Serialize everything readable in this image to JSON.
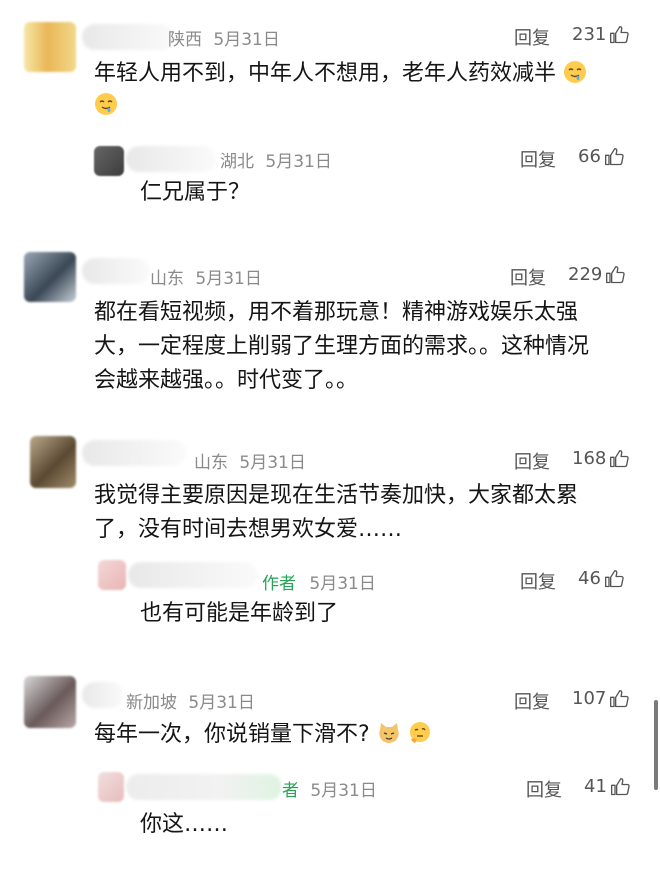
{
  "comments": [
    {
      "location": "陕西",
      "date": "5月31日",
      "reply_label": "回复",
      "likes": "231",
      "text": "年轻人用不到，中年人不想用，老年人药效减半",
      "reply": {
        "location": "湖北",
        "date": "5月31日",
        "reply_label": "回复",
        "likes": "66",
        "text": "仁兄属于？"
      }
    },
    {
      "location": "山东",
      "date": "5月31日",
      "reply_label": "回复",
      "likes": "229",
      "text_lines": [
        "都在看短视频，用不着那玩意！精神游戏娱乐太强",
        "大，一定程度上削弱了生理方面的需求。。这种情况",
        "会越来越强。。时代变了。。"
      ]
    },
    {
      "location": "山东",
      "date": "5月31日",
      "reply_label": "回复",
      "likes": "168",
      "text_lines": [
        "我觉得主要原因是现在生活节奏加快，大家都太累",
        "了，没有时间去想男欢女爱……"
      ],
      "reply": {
        "tag": "作者",
        "date": "5月31日",
        "reply_label": "回复",
        "likes": "46",
        "text": "也有可能是年龄到了"
      }
    },
    {
      "location": "新加坡",
      "date": "5月31日",
      "reply_label": "回复",
      "likes": "107",
      "text": "每年一次，你说销量下滑不?",
      "reply": {
        "tag": "者",
        "date": "5月31日",
        "reply_label": "回复",
        "likes": "41",
        "text": "你这……"
      }
    }
  ],
  "icons": {
    "like": "thumbs-up-icon",
    "emoji_drool": "drooling-face-emoji",
    "emoji_cat": "cat-face-emoji",
    "emoji_think": "thinking-face-emoji"
  }
}
